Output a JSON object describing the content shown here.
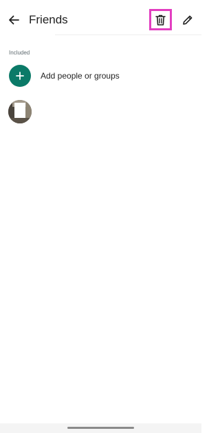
{
  "header": {
    "title": "Friends",
    "back_icon": "arrow-back-icon",
    "delete_icon": "trash-icon",
    "edit_icon": "pencil-icon",
    "highlight_color": "#e23ec0"
  },
  "section": {
    "label": "Included"
  },
  "add_row": {
    "label": "Add people or groups",
    "icon": "plus-icon",
    "accent_color": "#0b7a68"
  },
  "members": [
    {
      "avatar": "profile-photo"
    }
  ]
}
